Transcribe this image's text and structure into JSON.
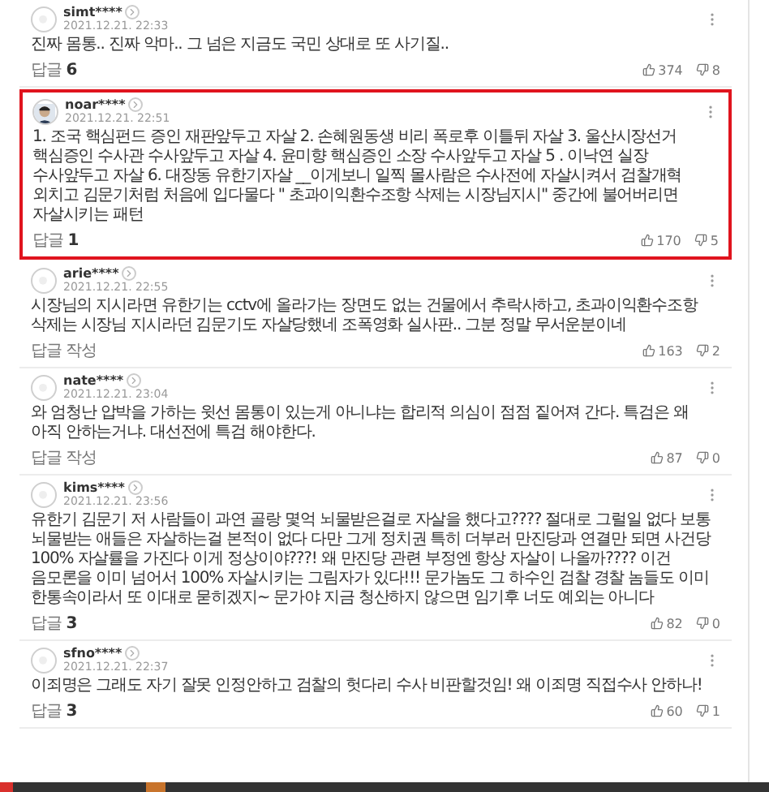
{
  "comments": [
    {
      "user": "simt****",
      "date": "2021.12.21. 22:33",
      "text": "진짜 몸통.. 진짜 악마.. 그 넘은 지금도 국민 상대로 또 사기질..",
      "reply": "답글 **6**",
      "likes": "374",
      "dislikes": "8",
      "highlighted": false,
      "kind": "blank"
    },
    {
      "user": "noar****",
      "date": "2021.12.21. 22:51",
      "text": "1. 조국 핵심펀드 증인 재판앞두고 자살 2. 손혜원동생 비리 폭로후 이틀뒤 자살 3. 울산시장선거 핵심증인 수사관 수사앞두고 자살 4. 윤미향 핵심증인 소장 수사앞두고 자살 5 . 이낙연 실장 수사앞두고 자살 6. 대장동 유한기자살 __이게보니 일찍 몰사람은 수사전에 자살시켜서 검찰개혁 외치고 김문기처럼 처음에 입다물다 \" 초과이익환수조항 삭제는 시장님지시\" 중간에 불어버리면 자살시키는 패턴",
      "reply": "답글 **1**",
      "likes": "170",
      "dislikes": "5",
      "highlighted": true,
      "kind": "photo"
    },
    {
      "user": "arie****",
      "date": "2021.12.21. 22:55",
      "text": "시장님의 지시라면 유한기는 cctv에 올라가는 장면도 없는 건물에서 추락사하고, 초과이익환수조항 삭제는 시장님 지시라던 김문기도 자살당했네 조폭영화 실사판.. 그분 정말 무서운분이네",
      "reply": "답글 작성",
      "likes": "163",
      "dislikes": "2",
      "highlighted": false,
      "kind": "blank"
    },
    {
      "user": "nate****",
      "date": "2021.12.21. 23:04",
      "text": "와 엄청난 압박을 가하는 윗선 몸통이 있는게 아니냐는 합리적 의심이 점점 짙어져 간다. 특검은 왜 아직 안하는거냐. 대선전에 특검 해야한다.",
      "reply": "답글 작성",
      "likes": "87",
      "dislikes": "0",
      "highlighted": false,
      "kind": "blank"
    },
    {
      "user": "kims****",
      "date": "2021.12.21. 23:56",
      "text": "유한기 김문기 저 사람들이 과연 골랑 몇억 뇌물받은걸로 자살을 했다고???? 절대로 그럴일 없다 보통 뇌물받는 애들은 자살하는걸 본적이 없다 다만 그게 정치권 특히 더부러 만진당과 연결만 되면 사건당 100% 자살률을 가진다 이게 정상이야???! 왜 만진당 관련 부정엔 항상 자살이 나올까???? 이건 음모론을 이미 넘어서 100% 자살시키는 그림자가 있다!!! 문가놈도 그 하수인 검찰 경찰 놈들도 이미 한통속이라서 또 이대로 묻히겠지~ 문가야 지금 청산하지 않으면 임기후 너도 예외는 아니다",
      "reply": "답글 **3**",
      "likes": "82",
      "dislikes": "0",
      "highlighted": false,
      "kind": "blank"
    },
    {
      "user": "sfno****",
      "date": "2021.12.21. 22:37",
      "text": "이죄명은 그래도 자기 잘못 인정안하고 검찰의 헛다리 수사 비판할것임! 왜 이죄명 직접수사 안하나!",
      "reply": "답글 **3**",
      "likes": "60",
      "dislikes": "1",
      "highlighted": false,
      "kind": "blank"
    }
  ]
}
